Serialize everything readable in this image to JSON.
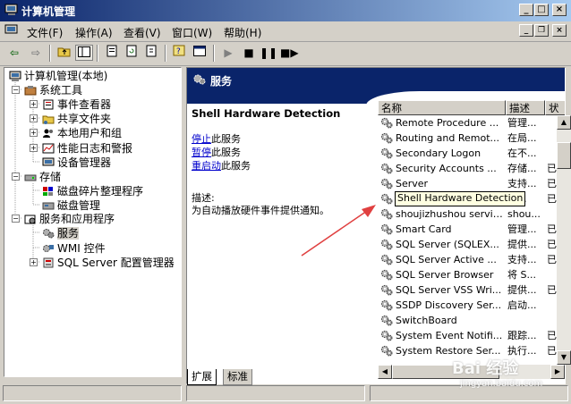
{
  "window": {
    "title": "计算机管理"
  },
  "menu": [
    "文件(F)",
    "操作(A)",
    "查看(V)",
    "窗口(W)",
    "帮助(H)"
  ],
  "tree": {
    "root": "计算机管理(本地)",
    "system_tools": "系统工具",
    "event_viewer": "事件查看器",
    "shared_folders": "共享文件夹",
    "local_users": "本地用户和组",
    "perf_logs": "性能日志和警报",
    "device_manager": "设备管理器",
    "storage": "存储",
    "defrag": "磁盘碎片整理程序",
    "disk_mgmt": "磁盘管理",
    "services_apps": "服务和应用程序",
    "services": "服务",
    "wmi": "WMI 控件",
    "sql_config": "SQL Server 配置管理器"
  },
  "pane": {
    "header_title": "服务",
    "service_name": "Shell Hardware Detection",
    "stop_link": "停止",
    "stop_rest": "此服务",
    "pause_link": "暂停",
    "pause_rest": "此服务",
    "restart_link": "重启动",
    "restart_rest": "此服务",
    "desc_label": "描述:",
    "desc_text": "为自动播放硬件事件提供通知。"
  },
  "columns": {
    "name": "名称",
    "desc": "描述",
    "status": "状"
  },
  "rows": [
    {
      "name": "Remote Procedure ...",
      "desc": "管理...",
      "status": ""
    },
    {
      "name": "Routing and Remot...",
      "desc": "在局...",
      "status": ""
    },
    {
      "name": "Secondary Logon",
      "desc": "在不...",
      "status": ""
    },
    {
      "name": "Security Accounts ...",
      "desc": "存储...",
      "status": "已"
    },
    {
      "name": "Server",
      "desc": "支持...",
      "status": "已"
    },
    {
      "name": "Shell Hardware Detection",
      "desc": "自...",
      "status": "已"
    },
    {
      "name": "shoujizhushou service",
      "desc": "shou...",
      "status": ""
    },
    {
      "name": "Smart Card",
      "desc": "管理...",
      "status": "已"
    },
    {
      "name": "SQL Server (SQLEX...",
      "desc": "提供...",
      "status": "已"
    },
    {
      "name": "SQL Server Active ...",
      "desc": "支持...",
      "status": "已"
    },
    {
      "name": "SQL Server Browser",
      "desc": "将 S...",
      "status": ""
    },
    {
      "name": "SQL Server VSS Wri...",
      "desc": "提供...",
      "status": "已"
    },
    {
      "name": "SSDP Discovery Ser...",
      "desc": "启动...",
      "status": ""
    },
    {
      "name": "SwitchBoard",
      "desc": "",
      "status": ""
    },
    {
      "name": "System Event Notifi...",
      "desc": "跟踪...",
      "status": "已"
    },
    {
      "name": "System Restore Ser...",
      "desc": "执行...",
      "status": "已"
    }
  ],
  "tooltip": "Shell Hardware Detection",
  "tabs": {
    "extended": "扩展",
    "standard": "标准"
  },
  "watermark": {
    "main": "Bai 经验",
    "sub": "jingyan.baidu.com"
  }
}
